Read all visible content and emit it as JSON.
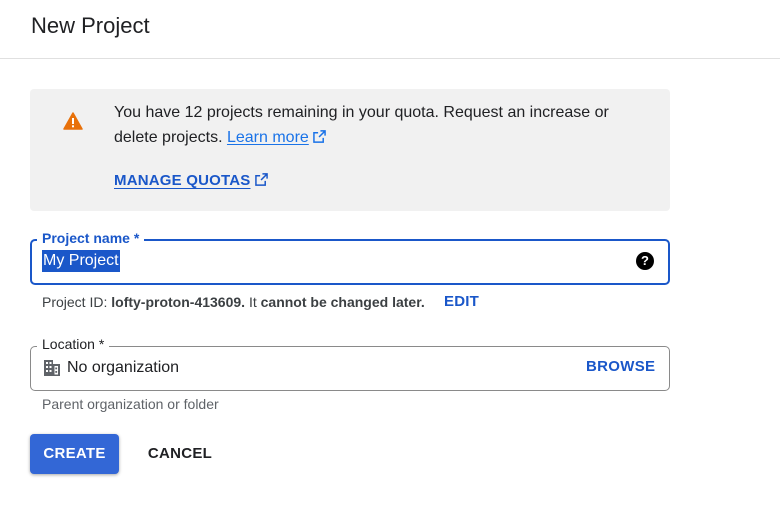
{
  "page": {
    "title": "New Project"
  },
  "notice": {
    "text_before_link": "You have 12 projects remaining in your quota. Request an increase or delete projects.",
    "learn_more": "Learn more",
    "manage_quotas": "MANAGE QUOTAS",
    "icon": "warning-icon",
    "icon_color": "#e8710a"
  },
  "project_name": {
    "label": "Project name *",
    "value": "My Project",
    "help_icon": "?"
  },
  "project_id": {
    "prefix": "Project ID:",
    "id": "lofty-proton-413609.",
    "middle": "It",
    "bold_suffix": "cannot be changed later.",
    "edit_label": "EDIT"
  },
  "location": {
    "label": "Location *",
    "value": "No organization",
    "browse_label": "BROWSE",
    "hint": "Parent organization or folder",
    "icon": "building-icon"
  },
  "actions": {
    "create_label": "CREATE",
    "cancel_label": "CANCEL"
  },
  "colors": {
    "accent": "#1a57c9",
    "primary_button": "#3367d6",
    "notice_bg": "#f1f1f1"
  }
}
